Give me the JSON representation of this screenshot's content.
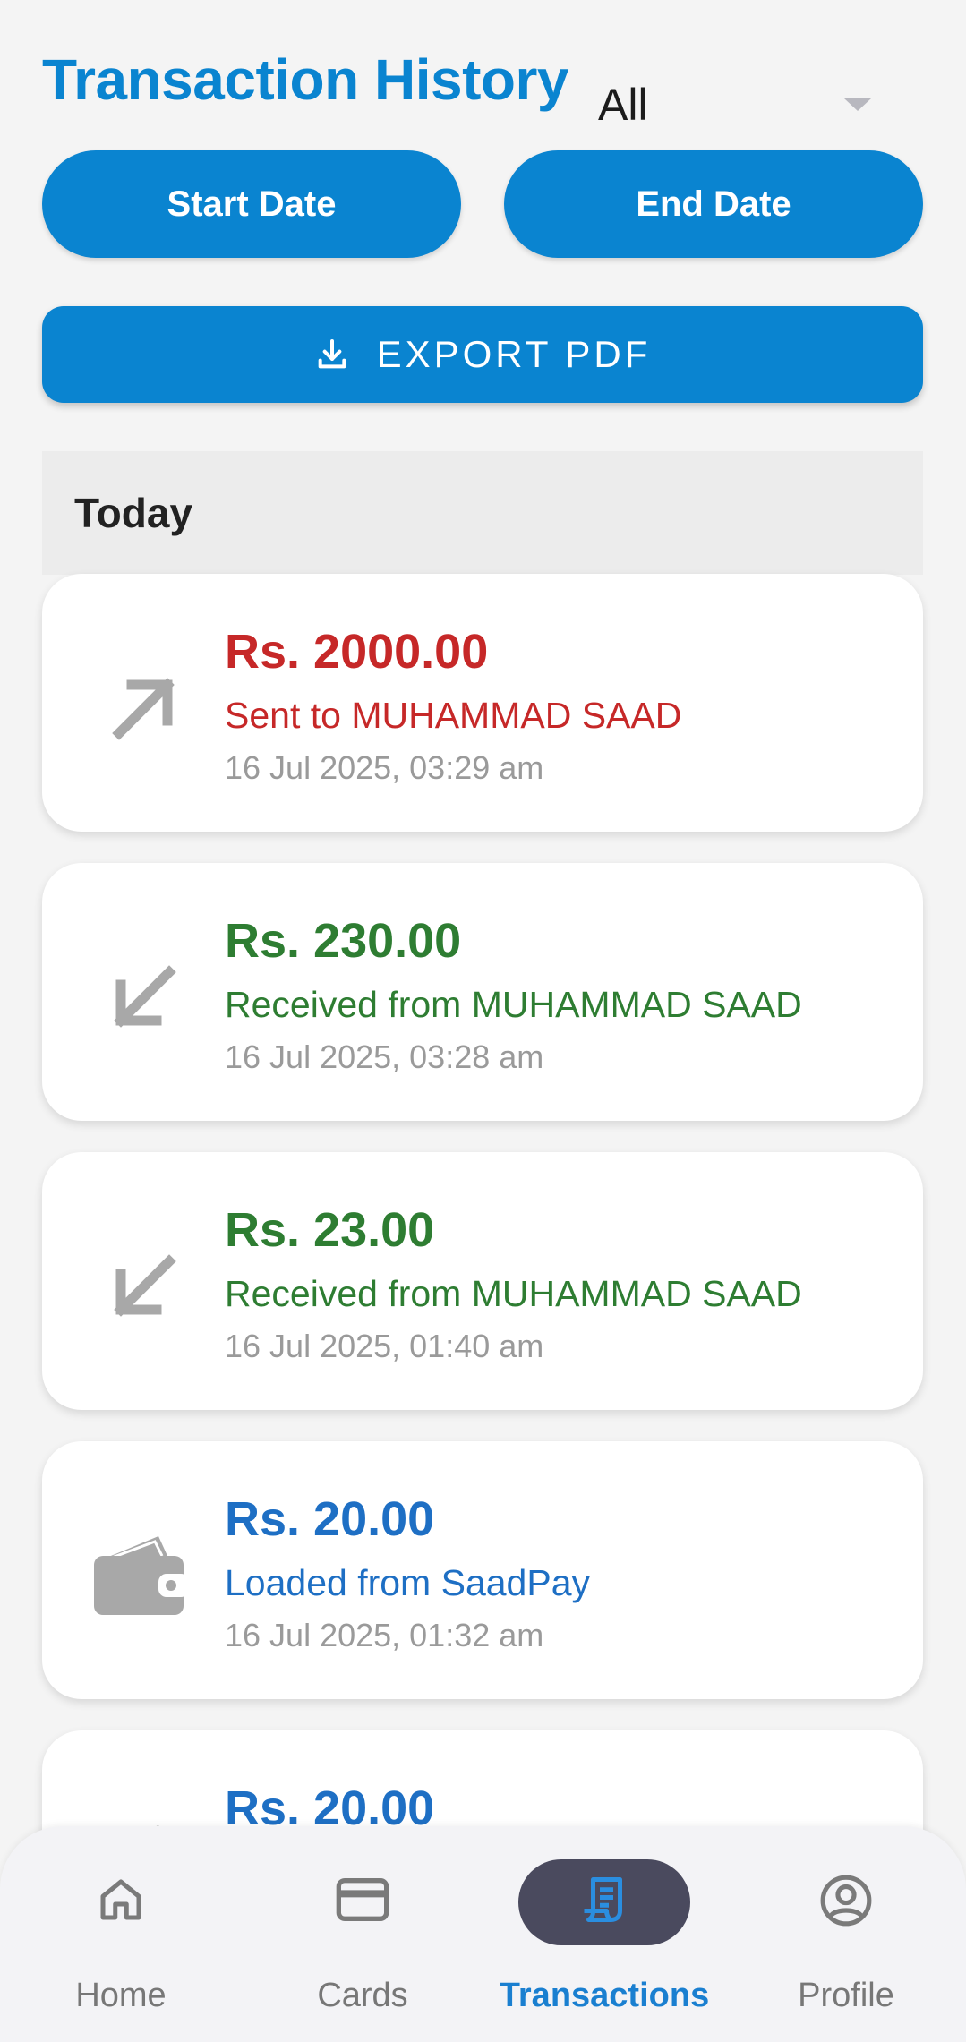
{
  "header": {
    "title": "Transaction History",
    "filter_value": "All"
  },
  "filters": {
    "start_label": "Start Date",
    "end_label": "End Date",
    "export_label": "EXPORT PDF"
  },
  "section": {
    "label": "Today"
  },
  "transactions": [
    {
      "amount": "Rs. 2000.00",
      "description": "Sent to MUHAMMAD SAAD",
      "time": "16 Jul 2025, 03:29 am",
      "type": "sent",
      "icon": "arrow-up-right-icon",
      "color": "#c62828"
    },
    {
      "amount": "Rs. 230.00",
      "description": "Received from MUHAMMAD SAAD",
      "time": "16 Jul 2025, 03:28 am",
      "type": "received",
      "icon": "arrow-down-left-icon",
      "color": "#2e7d32"
    },
    {
      "amount": "Rs. 23.00",
      "description": "Received from MUHAMMAD SAAD",
      "time": "16 Jul 2025, 01:40 am",
      "type": "received",
      "icon": "arrow-down-left-icon",
      "color": "#2e7d32"
    },
    {
      "amount": "Rs. 20.00",
      "description": "Loaded from SaadPay",
      "time": "16 Jul 2025, 01:32 am",
      "type": "loaded",
      "icon": "wallet-icon",
      "color": "#1e6fc4"
    },
    {
      "amount": "Rs. 20.00",
      "description": "",
      "time": "",
      "type": "loaded",
      "icon": "wallet-icon",
      "color": "#1e6fc4"
    }
  ],
  "nav": {
    "items": [
      {
        "label": "Home",
        "icon": "home-icon"
      },
      {
        "label": "Cards",
        "icon": "card-icon"
      },
      {
        "label": "Transactions",
        "icon": "receipt-icon",
        "active": true
      },
      {
        "label": "Profile",
        "icon": "profile-icon"
      }
    ]
  },
  "colors": {
    "primary": "#0a84d0",
    "sent": "#c62828",
    "received": "#2e7d32",
    "loaded": "#1e6fc4",
    "nav_active_pill": "#4a4a5e"
  }
}
